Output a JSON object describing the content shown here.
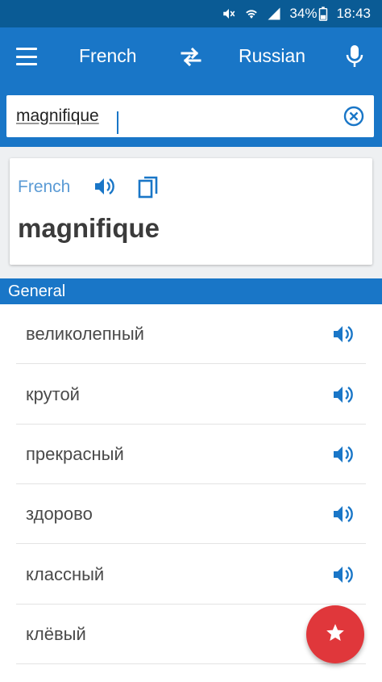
{
  "status_bar": {
    "battery": "34%",
    "time": "18:43"
  },
  "app_bar": {
    "source_lang": "French",
    "target_lang": "Russian"
  },
  "search": {
    "value": "magnifique"
  },
  "result_card": {
    "language": "French",
    "word": "magnifique"
  },
  "section": {
    "title": "General"
  },
  "translations": [
    {
      "word": "великолепный"
    },
    {
      "word": "крутой"
    },
    {
      "word": "прекрасный"
    },
    {
      "word": "здорово"
    },
    {
      "word": "классный"
    },
    {
      "word": "клёвый"
    }
  ],
  "colors": {
    "primary": "#1976c7",
    "status": "#0a5b95",
    "accent": "#e0373b",
    "speaker": "#1976c7"
  }
}
